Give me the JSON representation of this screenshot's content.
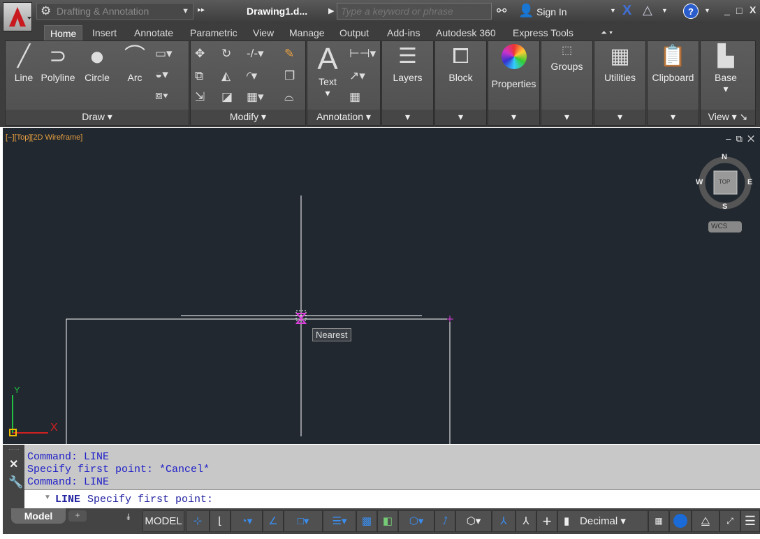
{
  "title_bar": {
    "workspace": "Drafting & Annotation",
    "document": "Drawing1.d...",
    "search_placeholder": "Type a keyword or phrase",
    "sign_in": "Sign In"
  },
  "tabs": [
    "Home",
    "Insert",
    "Annotate",
    "Parametric",
    "View",
    "Manage",
    "Output",
    "Add-ins",
    "Autodesk 360",
    "Express Tools"
  ],
  "ribbon": {
    "draw": {
      "title": "Draw",
      "buttons": [
        "Line",
        "Polyline",
        "Circle",
        "Arc"
      ]
    },
    "modify": {
      "title": "Modify"
    },
    "annotation": {
      "title": "Annotation",
      "buttons": [
        "Text"
      ]
    },
    "layers": "Layers",
    "block": "Block",
    "properties": "Properties",
    "groups": "Groups",
    "utilities": "Utilities",
    "clipboard": "Clipboard",
    "view": {
      "title": "View",
      "buttons": [
        "Base"
      ]
    }
  },
  "viewport": {
    "label": "[−][Top][2D Wireframe]",
    "viewcube": {
      "n": "N",
      "s": "S",
      "e": "E",
      "w": "W",
      "face": "TOP",
      "wcs": "WCS"
    },
    "tooltip": "Nearest",
    "ucs": {
      "x": "X",
      "y": "Y"
    }
  },
  "command": {
    "history": [
      "Command: LINE",
      "Specify first point: *Cancel*",
      "Command: LINE"
    ],
    "prompt_cmd": "LINE",
    "prompt_text": "Specify first point:"
  },
  "status": {
    "model_tab": "Model",
    "model_button": "MODEL",
    "units": "Decimal"
  }
}
